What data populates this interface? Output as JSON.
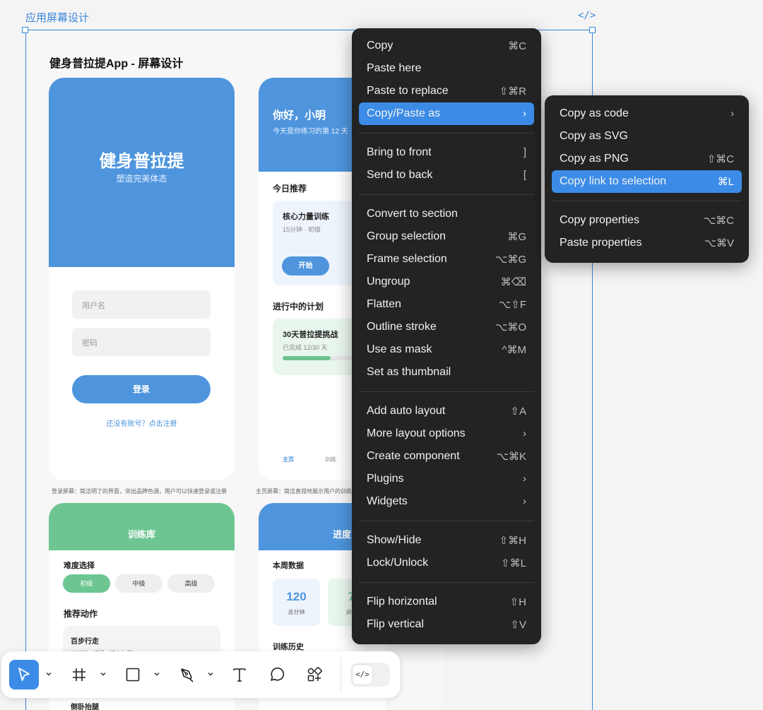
{
  "frame": {
    "label": "应用屏幕设计",
    "code_tag": "</>",
    "page_title": "健身普拉提App - 屏幕设计"
  },
  "login": {
    "title": "健身普拉提",
    "subtitle": "塑造完美体态",
    "username_placeholder": "用户名",
    "password_placeholder": "密码",
    "login_button": "登录",
    "register_link": "还没有账号？点击注册",
    "caption": "登录屏幕：简洁明了的界面，突出品牌色调，用户可以快速登录或注册"
  },
  "home": {
    "greeting": "你好，小明",
    "greeting_sub": "今天是你练习的第 12 天",
    "recommend_title": "今日推荐",
    "recommend_card_title": "核心力量训练",
    "recommend_card_meta": "15分钟 · 初级",
    "start_button": "开始",
    "plans_title": "进行中的计划",
    "plan_title": "30天普拉提挑战",
    "plan_meta": "已完成 12/30 天",
    "plan_progress": 0.4,
    "nav": [
      "主页",
      "训练"
    ],
    "caption": "主页屏幕：简洁直观地展示用户的训练"
  },
  "library": {
    "header": "训练库",
    "difficulty_title": "难度选择",
    "levels": [
      "初级",
      "中级",
      "高级"
    ],
    "recommend_title": "推荐动作",
    "exercise_1": "百步行走",
    "exercise_1_meta": "10分钟 · 初级 · 核心力量",
    "exercise_2": "侧卧抬腿"
  },
  "progress": {
    "header": "进度",
    "week_title": "本周数据",
    "stat_1_value": "120",
    "stat_1_label": "总分钟",
    "stat_2_value": "7",
    "stat_2_label": "训练",
    "history_title": "训练历史"
  },
  "context_menu": {
    "items": [
      {
        "label": "Copy",
        "shortcut": "⌘C"
      },
      {
        "label": "Paste here",
        "shortcut": ""
      },
      {
        "label": "Paste to replace",
        "shortcut": "⇧⌘R"
      },
      {
        "label": "Copy/Paste as",
        "shortcut": "›"
      },
      {
        "label": "Bring to front",
        "shortcut": "]"
      },
      {
        "label": "Send to back",
        "shortcut": "["
      },
      {
        "label": "Convert to section",
        "shortcut": ""
      },
      {
        "label": "Group selection",
        "shortcut": "⌘G"
      },
      {
        "label": "Frame selection",
        "shortcut": "⌥⌘G"
      },
      {
        "label": "Ungroup",
        "shortcut": "⌘⌫"
      },
      {
        "label": "Flatten",
        "shortcut": "⌥⇧F"
      },
      {
        "label": "Outline stroke",
        "shortcut": "⌥⌘O"
      },
      {
        "label": "Use as mask",
        "shortcut": "^⌘M"
      },
      {
        "label": "Set as thumbnail",
        "shortcut": ""
      },
      {
        "label": "Add auto layout",
        "shortcut": "⇧A"
      },
      {
        "label": "More layout options",
        "shortcut": "›"
      },
      {
        "label": "Create component",
        "shortcut": "⌥⌘K"
      },
      {
        "label": "Plugins",
        "shortcut": "›"
      },
      {
        "label": "Widgets",
        "shortcut": "›"
      },
      {
        "label": "Show/Hide",
        "shortcut": "⇧⌘H"
      },
      {
        "label": "Lock/Unlock",
        "shortcut": "⇧⌘L"
      },
      {
        "label": "Flip horizontal",
        "shortcut": "⇧H"
      },
      {
        "label": "Flip vertical",
        "shortcut": "⇧V"
      }
    ],
    "highlighted": "Copy/Paste as"
  },
  "submenu": {
    "items": [
      {
        "label": "Copy as code",
        "shortcut": "›"
      },
      {
        "label": "Copy as SVG",
        "shortcut": ""
      },
      {
        "label": "Copy as PNG",
        "shortcut": "⇧⌘C"
      },
      {
        "label": "Copy link to selection",
        "shortcut": "⌘L"
      },
      {
        "label": "Copy properties",
        "shortcut": "⌥⌘C"
      },
      {
        "label": "Paste properties",
        "shortcut": "⌥⌘V"
      }
    ],
    "highlighted": "Copy link to selection"
  },
  "toolbar": {
    "tools": [
      "move-tool",
      "frame-tool",
      "shape-tool",
      "pen-tool",
      "text-tool",
      "comment-tool",
      "actions-tool"
    ],
    "active_tool": "move-tool",
    "dev_mode_label": "</>"
  },
  "colors": {
    "accent": "#3c8ce7",
    "brand_blue": "#4e95dd",
    "brand_green": "#6dc692",
    "menu_bg": "#232323"
  }
}
